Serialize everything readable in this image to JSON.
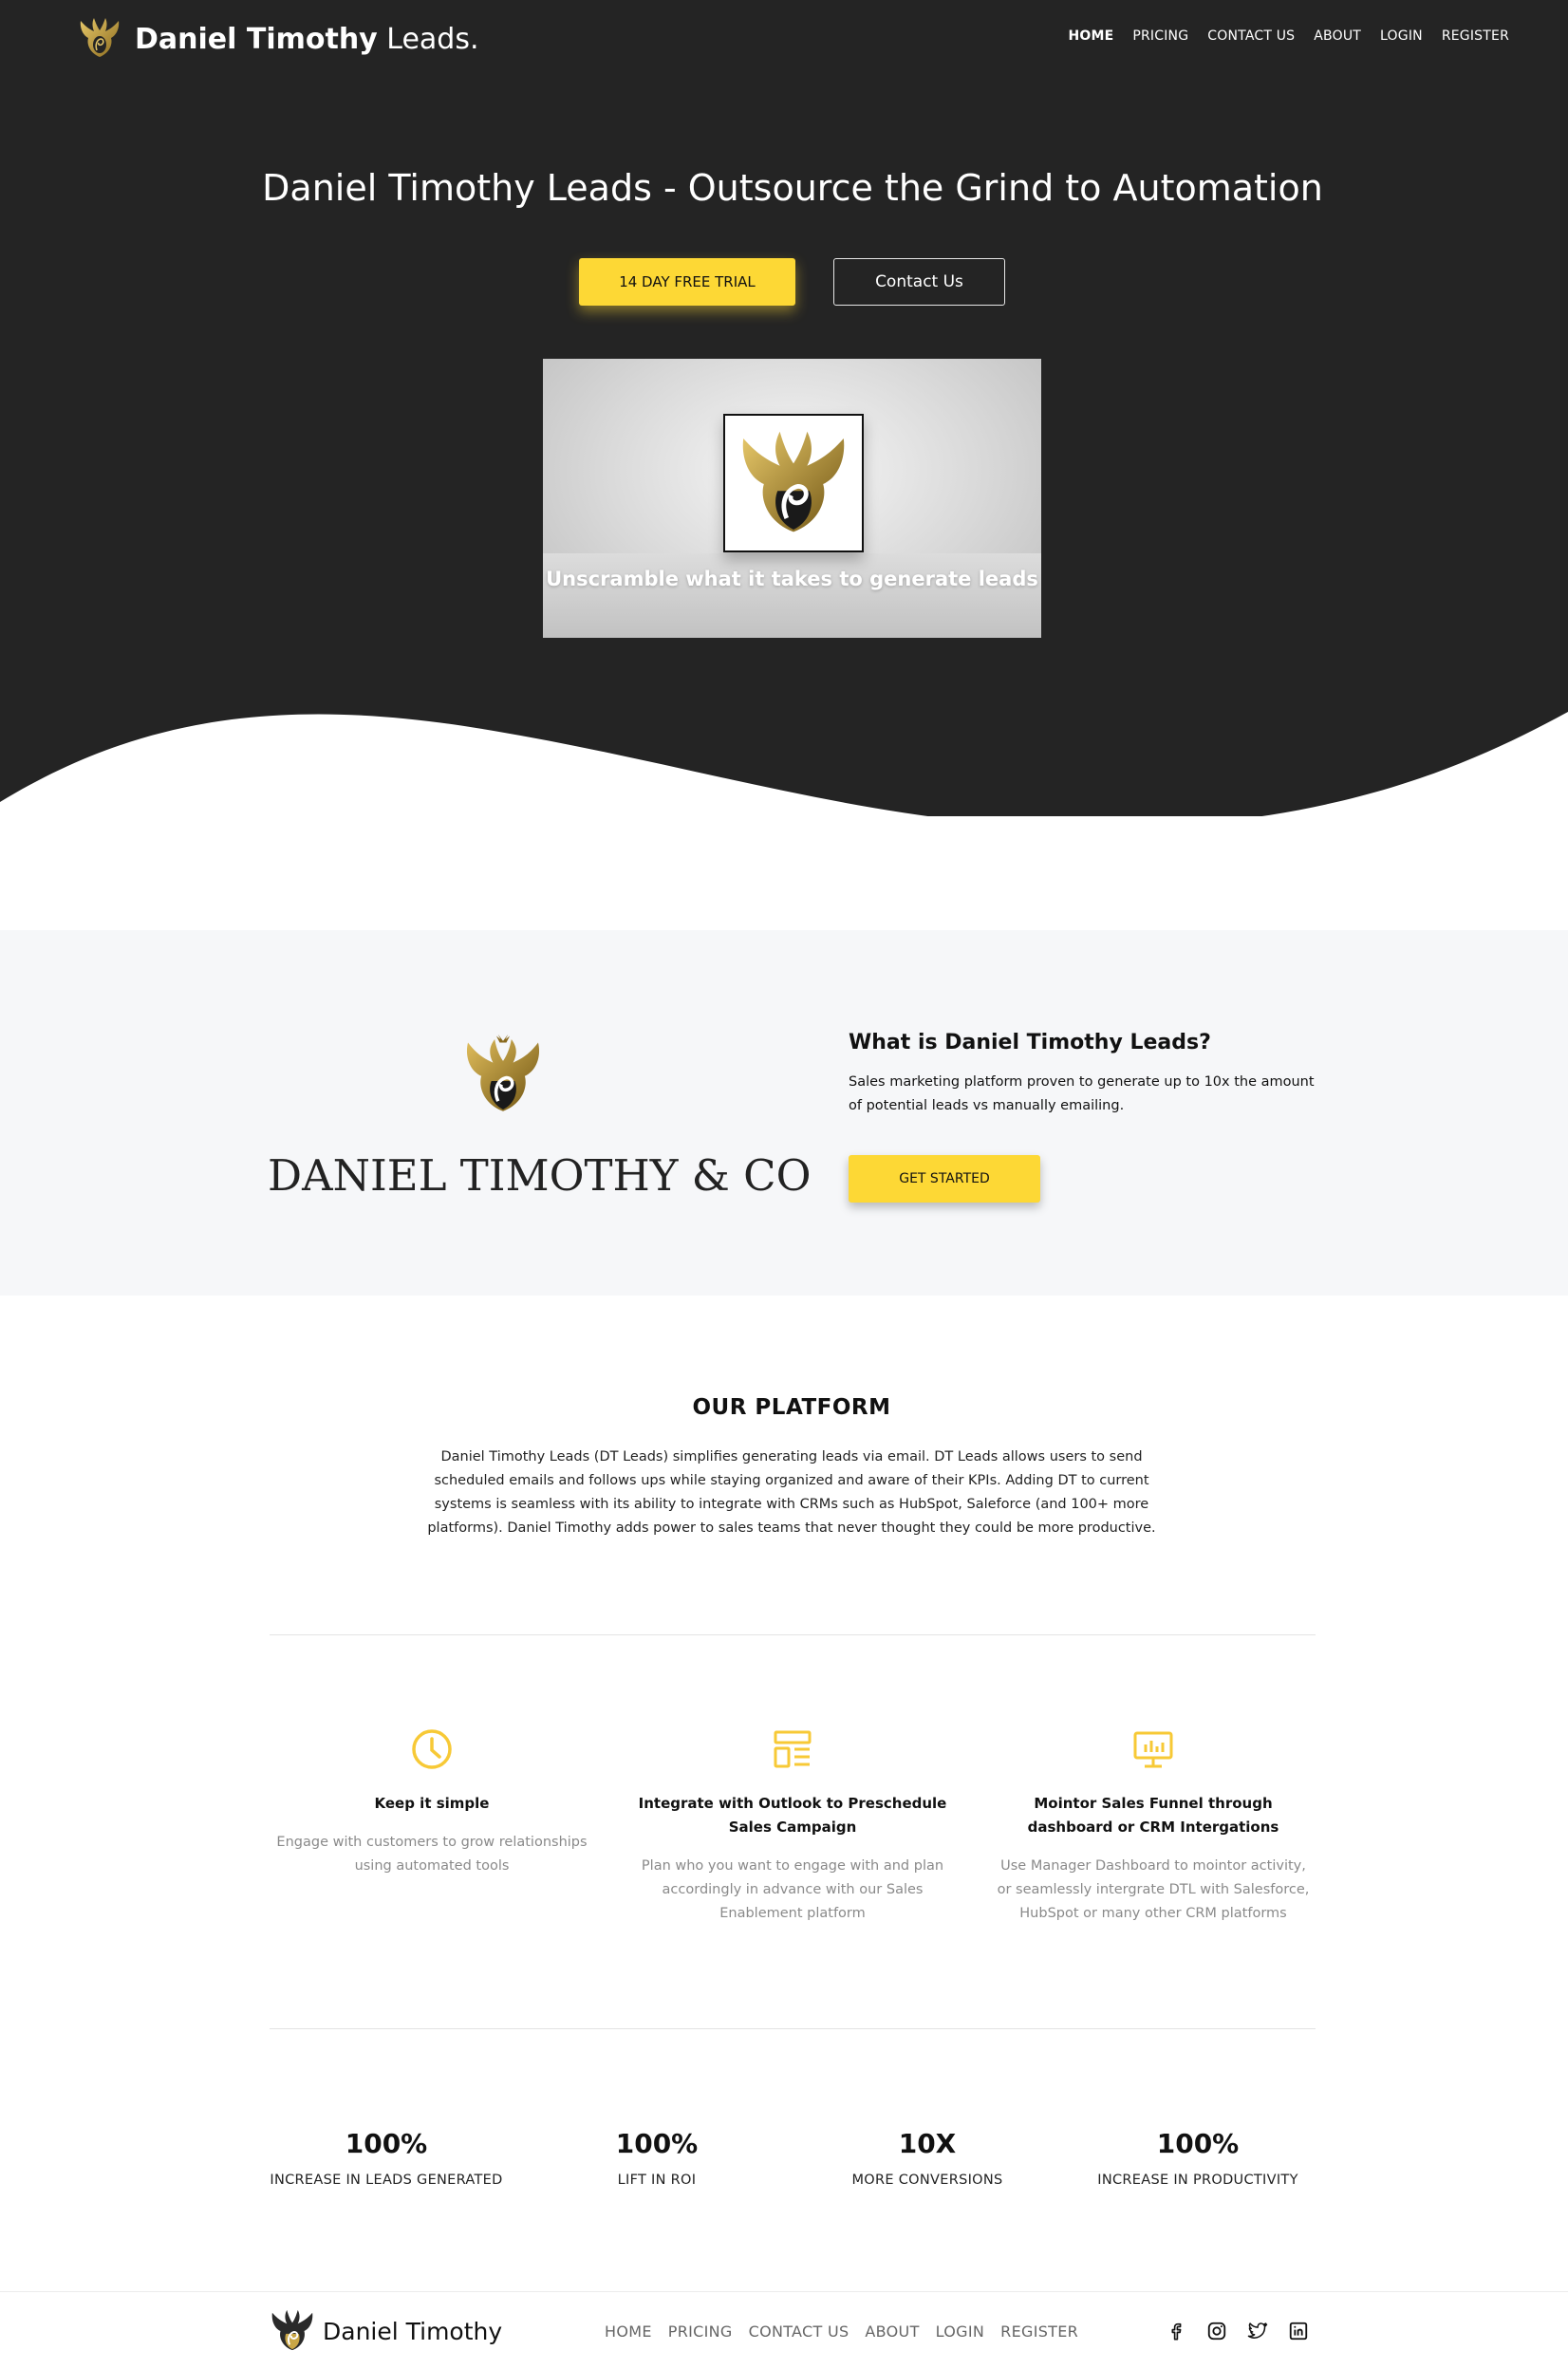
{
  "nav": {
    "brand_bold": "Daniel Timothy",
    "brand_light": "Leads.",
    "links": [
      "HOME",
      "PRICING",
      "CONTACT US",
      "ABOUT",
      "LOGIN",
      "REGISTER"
    ],
    "active": "HOME"
  },
  "hero": {
    "title": "Daniel Timothy Leads - Outsource the Grind to Automation",
    "trial_button": "14 DAY FREE TRIAL",
    "contact_button": "Contact Us",
    "video_caption": "Unscramble what it takes to generate leads"
  },
  "about": {
    "wordmark": "DANIEL TIMOTHY & CO",
    "heading": "What is Daniel Timothy Leads?",
    "text": "Sales marketing platform proven to generate up to 10x the amount of potential leads vs manually emailing.",
    "button": "GET STARTED"
  },
  "platform": {
    "heading": "OUR PLATFORM",
    "text": "Daniel Timothy Leads (DT Leads) simplifies generating leads via email. DT Leads allows users to send scheduled emails and follows ups while staying organized and aware of their KPIs. Adding DT to current systems is seamless with its ability to integrate with CRMs such as HubSpot, Saleforce (and 100+ more platforms). Daniel Timothy adds power to sales teams that never thought they could be more productive."
  },
  "features": [
    {
      "icon": "clock-icon",
      "title": "Keep it simple",
      "desc": "Engage with customers to grow relationships using automated tools"
    },
    {
      "icon": "layout-icon",
      "title": "Integrate with Outlook to Preschedule Sales Campaign",
      "desc": "Plan who you want to engage with and plan accordingly in advance with our Sales Enablement platform"
    },
    {
      "icon": "monitor-chart-icon",
      "title": "Mointor Sales Funnel through dashboard or CRM Intergations",
      "desc": "Use Manager Dashboard to mointor activity, or seamlessly intergrate DTL with Salesforce, HubSpot or many other CRM platforms"
    }
  ],
  "stats": [
    {
      "value": "100%",
      "label": "INCREASE IN LEADS GENERATED"
    },
    {
      "value": "100%",
      "label": "LIFT IN ROI"
    },
    {
      "value": "10X",
      "label": "MORE CONVERSIONS"
    },
    {
      "value": "100%",
      "label": "INCREASE IN PRODUCTIVITY"
    }
  ],
  "footer": {
    "name": "Daniel Timothy",
    "links": [
      "HOME",
      "PRICING",
      "CONTACT US",
      "ABOUT",
      "LOGIN",
      "REGISTER"
    ],
    "social": [
      "facebook-icon",
      "instagram-icon",
      "twitter-icon",
      "linkedin-icon"
    ]
  },
  "colors": {
    "hero_bg": "#242424",
    "accent_yellow": "#fdd835",
    "about_bg": "#f6f7f9",
    "icon_yellow": "#f7c936"
  }
}
